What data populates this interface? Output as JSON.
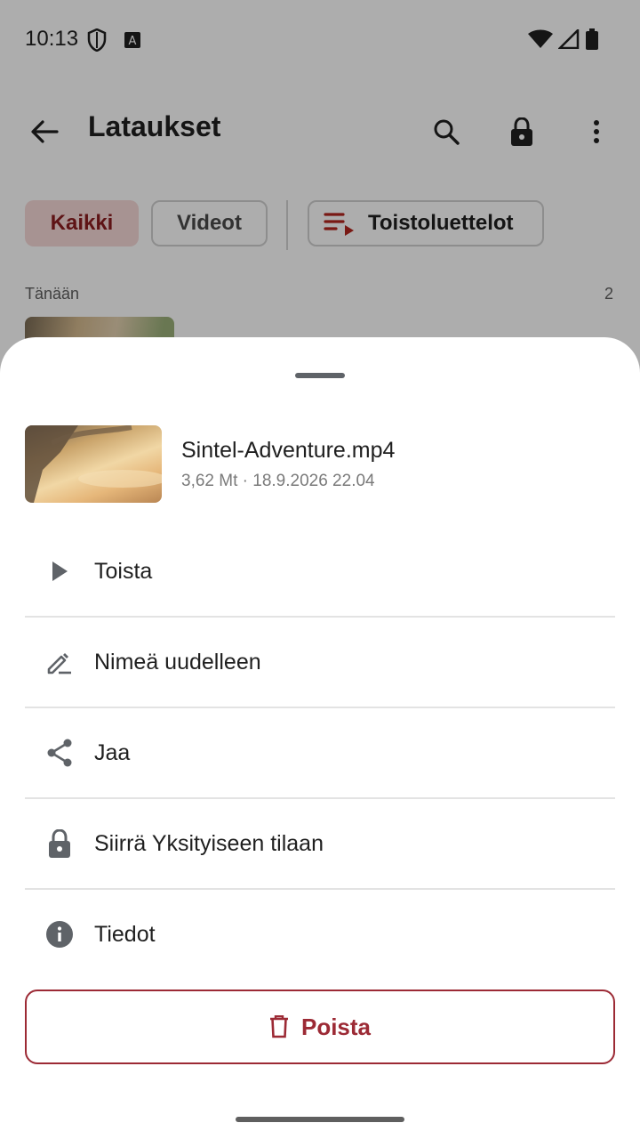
{
  "status_bar": {
    "time": "10:13"
  },
  "top_bar": {
    "title": "Lataukset"
  },
  "chips": {
    "all": "Kaikki",
    "videos": "Videot",
    "playlists": "Toistoluettelot"
  },
  "section": {
    "label": "Tänään",
    "count": "2"
  },
  "sheet": {
    "file": {
      "name": "Sintel-Adventure.mp4",
      "meta": "3,62 Mt · 18.9.2026 22.04"
    },
    "menu": [
      {
        "label": "Toista",
        "icon": "play-icon"
      },
      {
        "label": "Nimeä uudelleen",
        "icon": "rename-icon"
      },
      {
        "label": "Jaa",
        "icon": "share-icon"
      },
      {
        "label": "Siirrä Yksityiseen tilaan",
        "icon": "lock-icon"
      },
      {
        "label": "Tiedot",
        "icon": "info-icon"
      }
    ],
    "delete_label": "Poista"
  },
  "colors": {
    "accent": "#9c2a35",
    "chip_selected_bg": "#f6d9d8",
    "scrim": "#000000"
  }
}
